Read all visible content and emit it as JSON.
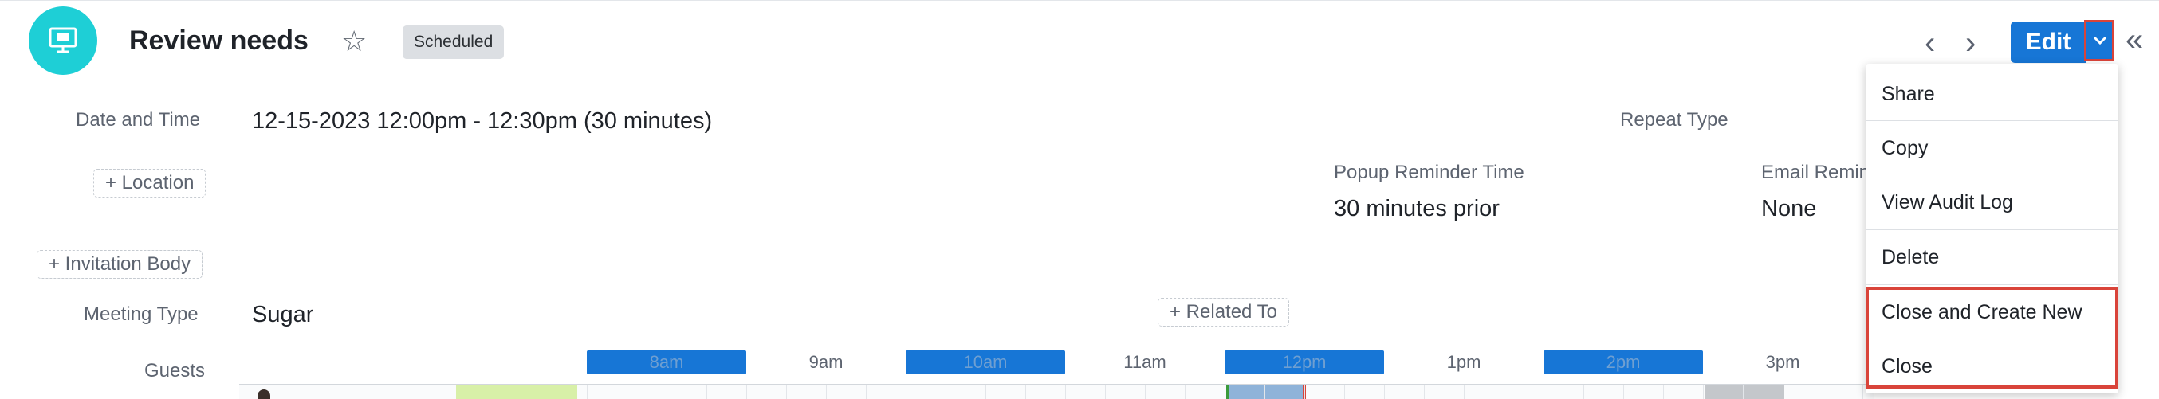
{
  "header": {
    "title": "Review needs",
    "status_badge": "Scheduled",
    "edit_label": "Edit"
  },
  "fields": {
    "date_time_label": "Date and Time",
    "date_time_value": "12-15-2023 12:00pm - 12:30pm (30 minutes)",
    "repeat_type_label": "Repeat Type",
    "location_pill": "+ Location",
    "popup_reminder_label": "Popup Reminder Time",
    "popup_reminder_value": "30 minutes prior",
    "email_reminder_label": "Email Remin",
    "email_reminder_value": "None",
    "invitation_body_pill": "+ Invitation Body",
    "meeting_type_label": "Meeting Type",
    "meeting_type_value": "Sugar",
    "related_to_pill": "+ Related To",
    "guests_label": "Guests"
  },
  "scheduler": {
    "hours": [
      {
        "label": "8am",
        "highlighted": true
      },
      {
        "label": "9am",
        "highlighted": false
      },
      {
        "label": "10am",
        "highlighted": true
      },
      {
        "label": "11am",
        "highlighted": false
      },
      {
        "label": "12pm",
        "highlighted": true
      },
      {
        "label": "1pm",
        "highlighted": false
      },
      {
        "label": "2pm",
        "highlighted": true
      },
      {
        "label": "3pm",
        "highlighted": false
      }
    ]
  },
  "menu": {
    "items": [
      "Share",
      "Copy",
      "View Audit Log",
      "Delete",
      "Close and Create New",
      "Close"
    ]
  },
  "colors": {
    "accent": "#1776d6",
    "avatar": "#1ecfd6",
    "highlight_box": "#d9443a"
  },
  "icons": {
    "avatar": "presentation-screen-icon",
    "favorite": "star-icon",
    "previous": "chevron-left-icon",
    "next": "chevron-right-icon",
    "dropdown": "chevron-down-icon",
    "collapse": "double-chevron-left-icon"
  }
}
